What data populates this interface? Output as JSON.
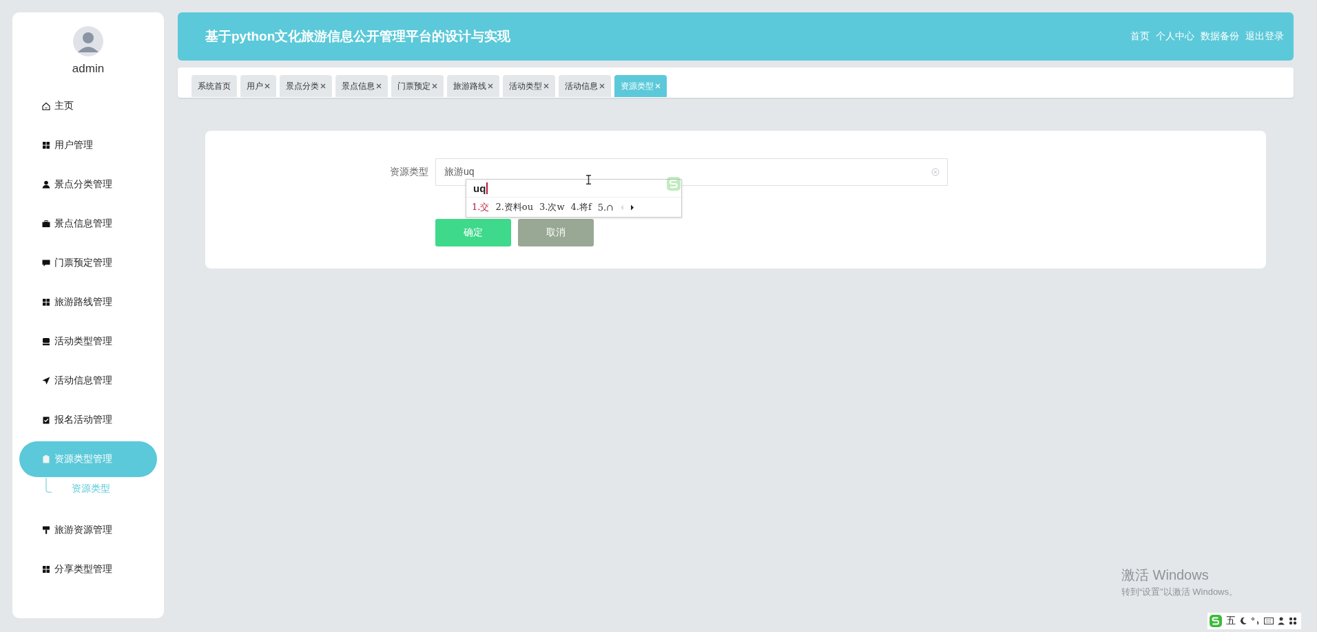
{
  "sidebar": {
    "user": "admin",
    "items": [
      {
        "label": "主页",
        "selected": false
      },
      {
        "label": "用户管理",
        "selected": false
      },
      {
        "label": "景点分类管理",
        "selected": false
      },
      {
        "label": "景点信息管理",
        "selected": false
      },
      {
        "label": "门票预定管理",
        "selected": false
      },
      {
        "label": "旅游路线管理",
        "selected": false
      },
      {
        "label": "活动类型管理",
        "selected": false
      },
      {
        "label": "活动信息管理",
        "selected": false
      },
      {
        "label": "报名活动管理",
        "selected": false
      },
      {
        "label": "资源类型管理",
        "selected": true,
        "children": [
          {
            "label": "资源类型",
            "selected": true
          }
        ]
      },
      {
        "label": "旅游资源管理",
        "selected": false
      },
      {
        "label": "分享类型管理",
        "selected": false
      }
    ]
  },
  "header": {
    "title": "基于python文化旅游信息公开管理平台的设计与实现",
    "links": [
      "首页",
      "个人中心",
      "数据备份",
      "退出登录"
    ]
  },
  "tabs": [
    {
      "label": "系统首页",
      "closable": false,
      "selected": false
    },
    {
      "label": "用户",
      "closable": true,
      "selected": false
    },
    {
      "label": "景点分类",
      "closable": true,
      "selected": false
    },
    {
      "label": "景点信息",
      "closable": true,
      "selected": false
    },
    {
      "label": "门票预定",
      "closable": true,
      "selected": false
    },
    {
      "label": "旅游路线",
      "closable": true,
      "selected": false
    },
    {
      "label": "活动类型",
      "closable": true,
      "selected": false
    },
    {
      "label": "活动信息",
      "closable": true,
      "selected": false
    },
    {
      "label": "资源类型",
      "closable": true,
      "selected": true
    }
  ],
  "form": {
    "fields": [
      {
        "label": "资源类型",
        "value": "旅游uq"
      }
    ],
    "buttons": [
      {
        "label": "确定",
        "kind": "primary"
      },
      {
        "label": "取消",
        "kind": "secondary"
      }
    ]
  },
  "ime": {
    "composition": "uq",
    "candidates": [
      {
        "label": "1.交",
        "selected": true
      },
      {
        "label": "2.资料ou",
        "selected": false
      },
      {
        "label": "3.次w",
        "selected": false
      },
      {
        "label": "4.将f",
        "selected": false
      },
      {
        "label": "5.∩",
        "selected": false
      }
    ],
    "status": "五"
  },
  "os_notice": {
    "title": "激活 Windows",
    "text": "转到“设置”以激活 Windows。"
  }
}
